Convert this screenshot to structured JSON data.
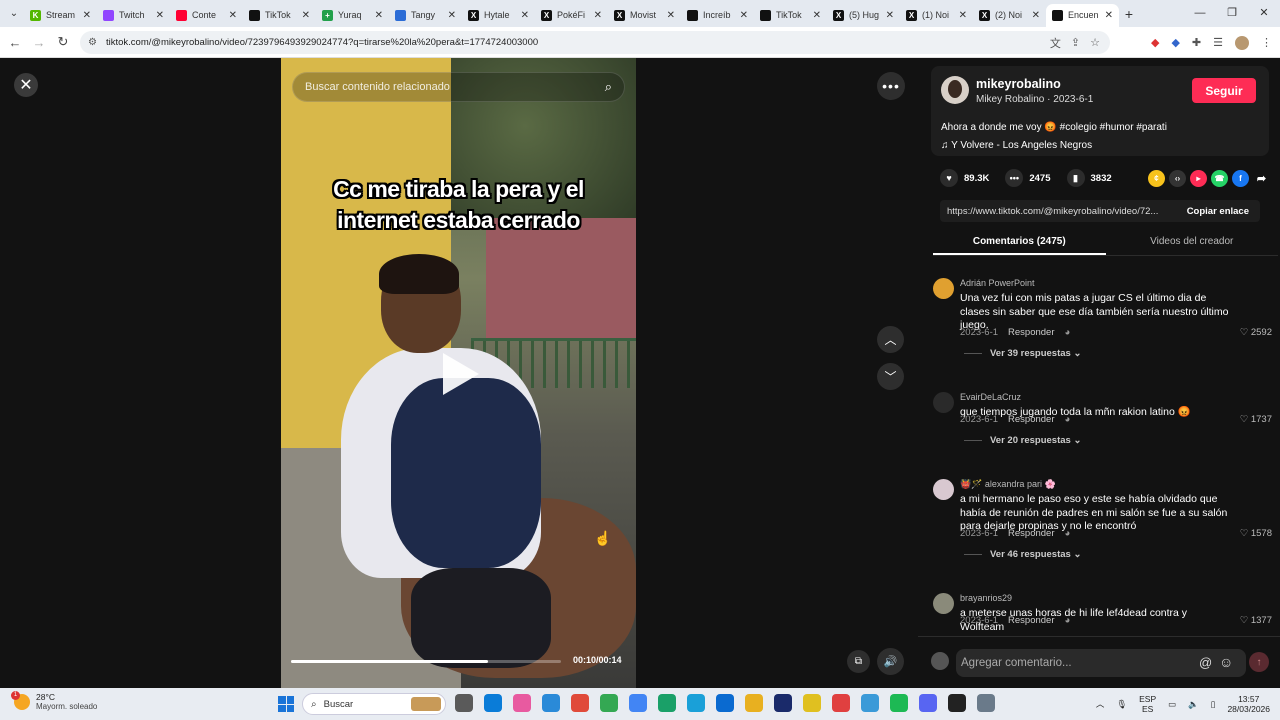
{
  "browser": {
    "tabs": [
      {
        "title": "Stream",
        "color": "#53b700",
        "glyph": "K"
      },
      {
        "title": "Twitch",
        "color": "#9146ff",
        "glyph": ""
      },
      {
        "title": "Conte",
        "color": "#ff0033",
        "glyph": ""
      },
      {
        "title": "TikTok",
        "color": "#111111",
        "glyph": ""
      },
      {
        "title": "Yuraq",
        "color": "#22a04b",
        "glyph": "+"
      },
      {
        "title": "Tangy",
        "color": "#2b6cd6",
        "glyph": ""
      },
      {
        "title": "Hytale",
        "color": "#111111",
        "glyph": "X"
      },
      {
        "title": "PokéFi",
        "color": "#111111",
        "glyph": "X"
      },
      {
        "title": "Movist",
        "color": "#111111",
        "glyph": "X"
      },
      {
        "title": "Increíb",
        "color": "#111111",
        "glyph": ""
      },
      {
        "title": "TikTok",
        "color": "#111111",
        "glyph": ""
      },
      {
        "title": "(5) Hug",
        "color": "#111111",
        "glyph": "X"
      },
      {
        "title": "(1) Noi",
        "color": "#111111",
        "glyph": "X"
      },
      {
        "title": "(2) Noi",
        "color": "#111111",
        "glyph": "X"
      },
      {
        "title": "Encuen",
        "color": "#111111",
        "glyph": "",
        "active": true
      }
    ],
    "url": "tiktok.com/@mikeyrobalino/video/7239796493929024774?q=tirarse%20la%20pera&t=1774724003000"
  },
  "video": {
    "search_placeholder": "Buscar contenido relacionado",
    "caption_line1": "Cc me tiraba la pera y el",
    "caption_line2": "internet estaba cerrado",
    "timecode": "00:10/00:14",
    "progress": 0.73
  },
  "creator": {
    "username": "mikeyrobalino",
    "meta": "Mikey Robalino · 2023-6-1",
    "follow_label": "Seguir",
    "description": "Ahora a donde me voy 😡 #colegio #humor #parati",
    "music": "♫  Y Volvere - Los Angeles Negros"
  },
  "actions": {
    "likes": "89.3K",
    "comments": "2475",
    "saves": "3832",
    "share_colors": [
      "#f7c21c",
      "#333333",
      "#fe2c55",
      "#25d366",
      "#1877f2"
    ]
  },
  "link": {
    "url": "https://www.tiktok.com/@mikeyrobalino/video/72...",
    "copy_label": "Copiar enlace"
  },
  "tabs": {
    "comments_tab": "Comentarios (2475)",
    "creator_tab": "Videos del creador"
  },
  "comments": [
    {
      "name": "Adrián PowerPoint",
      "text": "Una vez fui con mis patas a jugar CS el último dia de clases sin saber que ese día también sería nuestro último juego.",
      "date": "2023-6-1",
      "reply": "Responder",
      "likes": "2592",
      "replies": "Ver 39 respuestas",
      "avatar": "#e0a030"
    },
    {
      "name": "EvairDeLaCruz",
      "text": "que tiempos jugando toda la mñn rakion latino 😡",
      "date": "2023-6-1",
      "reply": "Responder",
      "likes": "1737",
      "replies": "Ver 20 respuestas",
      "avatar": "#2a2a2a"
    },
    {
      "name": "👹🪄 alexandra pari 🌸",
      "text": "a mi hermano le paso eso y este se había olvidado que había de reunión de padres en mi salón se fue a su salón para dejarle propinas y no le encontró",
      "date": "2023-6-1",
      "reply": "Responder",
      "likes": "1578",
      "replies": "Ver 46 respuestas",
      "avatar": "#d8c8d0"
    },
    {
      "name": "brayanrios29",
      "text": "a meterse unas horas de hi life lef4dead contra y Wolfteam",
      "date": "2023-6-1",
      "reply": "Responder",
      "likes": "1377",
      "replies": "",
      "avatar": "#8a8a7a"
    }
  ],
  "composer": {
    "placeholder": "Agregar comentario..."
  },
  "taskbar": {
    "temp": "28°C",
    "weather": "Mayorm. soleado",
    "weather_badge": "1",
    "search_label": "Buscar",
    "lang1": "ESP",
    "lang2": "ES",
    "time": "13:57",
    "date": "28/03/2026",
    "app_colors": [
      "#5a5a5a",
      "#0a7cd8",
      "#e85aa0",
      "#2a8ad8",
      "#e04a3a",
      "#34a853",
      "#4285f4",
      "#1aa068",
      "#1aa0d8",
      "#0a6ad0",
      "#e8b020",
      "#1a2a6a",
      "#e0c020",
      "#e04040",
      "#3a9ad8",
      "#1db954",
      "#5865f2",
      "#222222",
      "#6a7a8a"
    ]
  }
}
